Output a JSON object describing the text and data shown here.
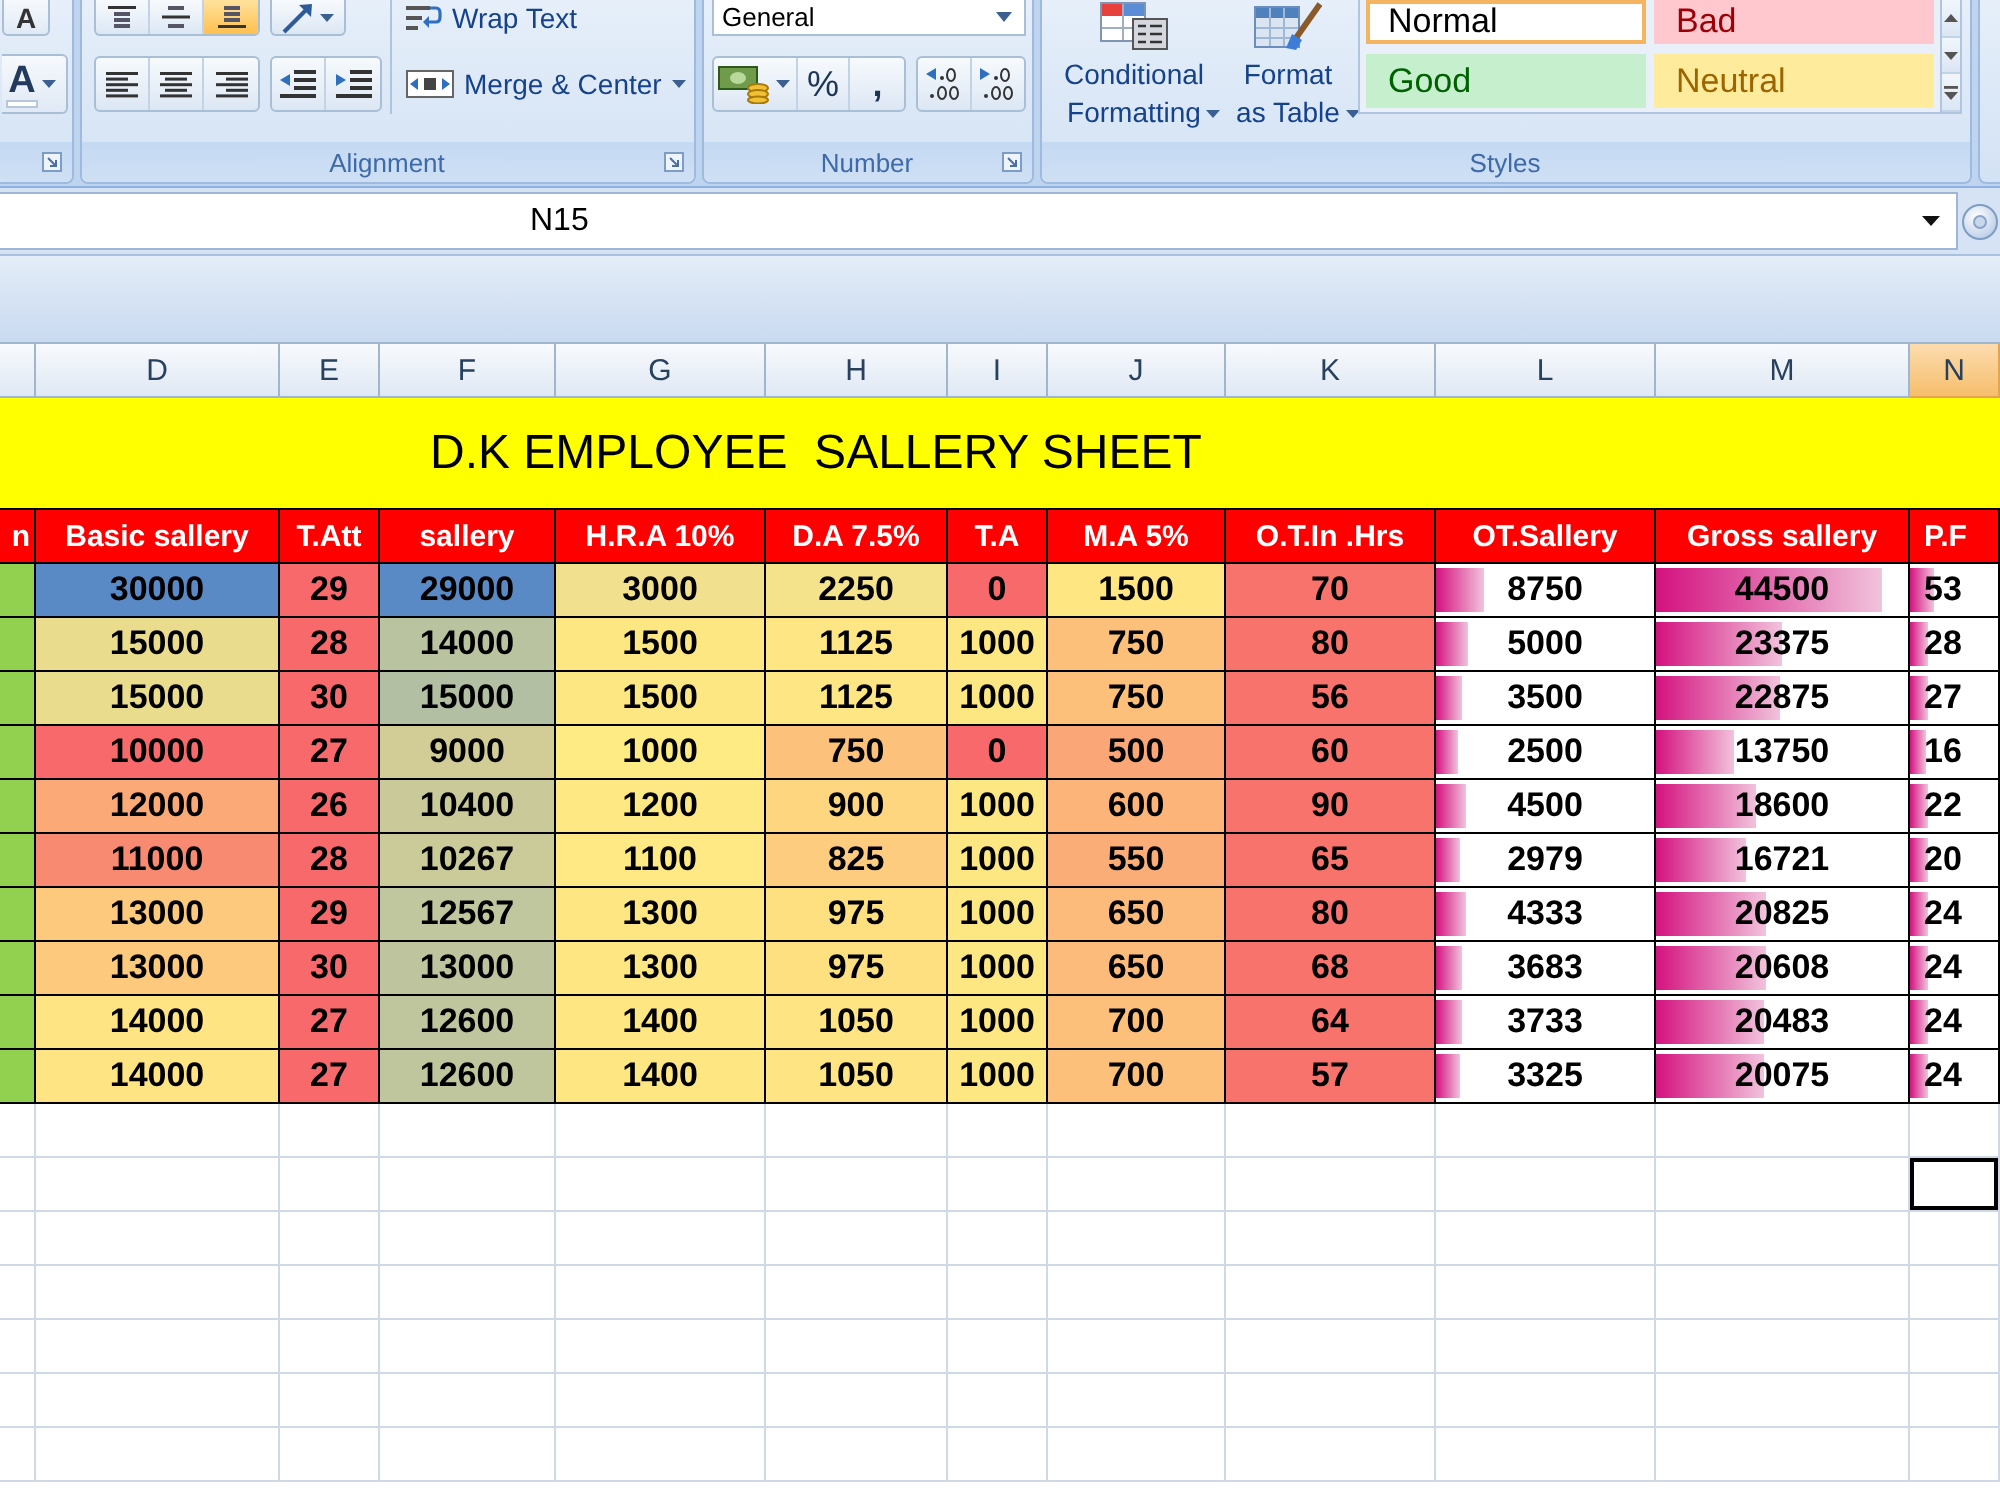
{
  "ribbon": {
    "font_group": {
      "grow_font_button": "A",
      "font_color_button": "A"
    },
    "alignment_group": {
      "vertical_align_buttons": [
        {
          "kind": "top",
          "selected": false
        },
        {
          "kind": "middle",
          "selected": false
        },
        {
          "kind": "bottom",
          "selected": true
        }
      ],
      "wrap_text_button": "Wrap Text",
      "merge_center_button": "Merge & Center",
      "label": "Alignment"
    },
    "number_group": {
      "format_dropdown": "General",
      "percent_button": "%",
      "comma_button": ",",
      "label": "Number"
    },
    "styles_group": {
      "conditional_formatting_button": "Conditional Formatting",
      "format_as_table_button": "Format as Table",
      "cell_styles": [
        {
          "label": "Normal",
          "kind": "normal",
          "selected": true
        },
        {
          "label": "Bad",
          "kind": "bad",
          "selected": false
        },
        {
          "label": "Good",
          "kind": "good",
          "selected": false
        },
        {
          "label": "Neutral",
          "kind": "neutral",
          "selected": false
        }
      ],
      "label": "Styles"
    }
  },
  "formula_bar": {
    "name_box": "N15"
  },
  "sheet": {
    "columns": [
      {
        "selected": false
      },
      {
        "label": "D",
        "selected": false
      },
      {
        "label": "E",
        "selected": false
      },
      {
        "label": "F",
        "selected": false
      },
      {
        "label": "G",
        "selected": false
      },
      {
        "label": "H",
        "selected": false
      },
      {
        "label": "I",
        "selected": false
      },
      {
        "label": "J",
        "selected": false
      },
      {
        "label": "K",
        "selected": false
      },
      {
        "label": "L",
        "selected": false
      },
      {
        "label": "M",
        "selected": false
      },
      {
        "label": "N",
        "selected": true
      }
    ],
    "title": "D.K EMPLOYEE  SALLERY SHEET",
    "header": [
      "n",
      "Basic sallery",
      "T.Att",
      "sallery",
      "H.R.A 10%",
      "D.A 7.5%",
      "T.A",
      "M.A 5%",
      "O.T.In .Hrs",
      "OT.Sallery",
      "Gross sallery",
      "P.F"
    ],
    "rows": [
      {
        "cells": [
          {
            "color": "#92d050"
          },
          {
            "text": "30000",
            "color": "#5a8ac6"
          },
          {
            "text": "29",
            "color": "#f8696b"
          },
          {
            "text": "29000",
            "color": "#5a8ac6"
          },
          {
            "text": "3000",
            "color": "#f1e08d"
          },
          {
            "text": "2250",
            "color": "#f4e38a"
          },
          {
            "text": "0",
            "color": "#f8696b"
          },
          {
            "text": "1500",
            "color": "#fee783"
          },
          {
            "text": "70",
            "color": "#f8736c"
          },
          {
            "text": "8750",
            "level": 0.22
          },
          {
            "text": "44500",
            "level": 0.9
          },
          {
            "text": "53",
            "level": 0.28
          }
        ]
      },
      {
        "cells": [
          {
            "color": "#92d050"
          },
          {
            "text": "15000",
            "color": "#e9dd8d"
          },
          {
            "text": "28",
            "color": "#f8696b"
          },
          {
            "text": "14000",
            "color": "#b9c3a0"
          },
          {
            "text": "1500",
            "color": "#fde783"
          },
          {
            "text": "1125",
            "color": "#fde683"
          },
          {
            "text": "1000",
            "color": "#fde783"
          },
          {
            "text": "750",
            "color": "#fcc07b"
          },
          {
            "text": "80",
            "color": "#f8736c"
          },
          {
            "text": "5000",
            "level": 0.15
          },
          {
            "text": "23375",
            "level": 0.5
          },
          {
            "text": "28",
            "level": 0.2
          }
        ]
      },
      {
        "cells": [
          {
            "color": "#92d050"
          },
          {
            "text": "15000",
            "color": "#e9dd8d"
          },
          {
            "text": "30",
            "color": "#f8696b"
          },
          {
            "text": "15000",
            "color": "#b3bfa3"
          },
          {
            "text": "1500",
            "color": "#fde783"
          },
          {
            "text": "1125",
            "color": "#fde683"
          },
          {
            "text": "1000",
            "color": "#fde783"
          },
          {
            "text": "750",
            "color": "#fcc07b"
          },
          {
            "text": "56",
            "color": "#f8736c"
          },
          {
            "text": "3500",
            "level": 0.12
          },
          {
            "text": "22875",
            "level": 0.49
          },
          {
            "text": "27",
            "level": 0.2
          }
        ]
      },
      {
        "cells": [
          {
            "color": "#92d050"
          },
          {
            "text": "10000",
            "color": "#f8696b"
          },
          {
            "text": "27",
            "color": "#f8696b"
          },
          {
            "text": "9000",
            "color": "#d2cd96"
          },
          {
            "text": "1000",
            "color": "#ffeb84"
          },
          {
            "text": "750",
            "color": "#fcc27b"
          },
          {
            "text": "0",
            "color": "#f8696b"
          },
          {
            "text": "500",
            "color": "#fba677"
          },
          {
            "text": "60",
            "color": "#f8736c"
          },
          {
            "text": "2500",
            "level": 0.1
          },
          {
            "text": "13750",
            "level": 0.31
          },
          {
            "text": "16",
            "level": 0.18
          }
        ]
      },
      {
        "cells": [
          {
            "color": "#92d050"
          },
          {
            "text": "12000",
            "color": "#fbaa77"
          },
          {
            "text": "26",
            "color": "#f8696b"
          },
          {
            "text": "10400",
            "color": "#cac99a"
          },
          {
            "text": "1200",
            "color": "#fee883"
          },
          {
            "text": "900",
            "color": "#fed680"
          },
          {
            "text": "1000",
            "color": "#fde783"
          },
          {
            "text": "600",
            "color": "#fcb479"
          },
          {
            "text": "90",
            "color": "#f8736c"
          },
          {
            "text": "4500",
            "level": 0.14
          },
          {
            "text": "18600",
            "level": 0.4
          },
          {
            "text": "22",
            "level": 0.2
          }
        ]
      },
      {
        "cells": [
          {
            "color": "#92d050"
          },
          {
            "text": "11000",
            "color": "#f98a72"
          },
          {
            "text": "28",
            "color": "#f8696b"
          },
          {
            "text": "10267",
            "color": "#cbca99"
          },
          {
            "text": "1100",
            "color": "#fee984"
          },
          {
            "text": "825",
            "color": "#fdcc7e"
          },
          {
            "text": "1000",
            "color": "#fde783"
          },
          {
            "text": "550",
            "color": "#fbad78"
          },
          {
            "text": "65",
            "color": "#f8736c"
          },
          {
            "text": "2979",
            "level": 0.11
          },
          {
            "text": "16721",
            "level": 0.36
          },
          {
            "text": "20",
            "level": 0.2
          }
        ]
      },
      {
        "cells": [
          {
            "color": "#92d050"
          },
          {
            "text": "13000",
            "color": "#fdc97d"
          },
          {
            "text": "29",
            "color": "#f8696b"
          },
          {
            "text": "12567",
            "color": "#c0c69d"
          },
          {
            "text": "1300",
            "color": "#fee783"
          },
          {
            "text": "975",
            "color": "#fee081"
          },
          {
            "text": "1000",
            "color": "#fde783"
          },
          {
            "text": "650",
            "color": "#fcbb7a"
          },
          {
            "text": "80",
            "color": "#f8736c"
          },
          {
            "text": "4333",
            "level": 0.14
          },
          {
            "text": "20825",
            "level": 0.44
          },
          {
            "text": "24",
            "level": 0.2
          }
        ]
      },
      {
        "cells": [
          {
            "color": "#92d050"
          },
          {
            "text": "13000",
            "color": "#fdc97d"
          },
          {
            "text": "30",
            "color": "#f8696b"
          },
          {
            "text": "13000",
            "color": "#bdc49e"
          },
          {
            "text": "1300",
            "color": "#fee783"
          },
          {
            "text": "975",
            "color": "#fee081"
          },
          {
            "text": "1000",
            "color": "#fde783"
          },
          {
            "text": "650",
            "color": "#fcbb7a"
          },
          {
            "text": "68",
            "color": "#f8736c"
          },
          {
            "text": "3683",
            "level": 0.12
          },
          {
            "text": "20608",
            "level": 0.44
          },
          {
            "text": "24",
            "level": 0.2
          }
        ]
      },
      {
        "cells": [
          {
            "color": "#92d050"
          },
          {
            "text": "14000",
            "color": "#fee482"
          },
          {
            "text": "27",
            "color": "#f8696b"
          },
          {
            "text": "12600",
            "color": "#bfc59d"
          },
          {
            "text": "1400",
            "color": "#fee783"
          },
          {
            "text": "1050",
            "color": "#fee482"
          },
          {
            "text": "1000",
            "color": "#fde783"
          },
          {
            "text": "700",
            "color": "#fcc07b"
          },
          {
            "text": "64",
            "color": "#f8736c"
          },
          {
            "text": "3733",
            "level": 0.12
          },
          {
            "text": "20483",
            "level": 0.43
          },
          {
            "text": "24",
            "level": 0.2
          }
        ]
      },
      {
        "cells": [
          {
            "color": "#92d050"
          },
          {
            "text": "14000",
            "color": "#fee482"
          },
          {
            "text": "27",
            "color": "#f8696b"
          },
          {
            "text": "12600",
            "color": "#bfc59d"
          },
          {
            "text": "1400",
            "color": "#fee783"
          },
          {
            "text": "1050",
            "color": "#fee482"
          },
          {
            "text": "1000",
            "color": "#fde783"
          },
          {
            "text": "700",
            "color": "#fcc07b"
          },
          {
            "text": "57",
            "color": "#f8736c"
          },
          {
            "text": "3325",
            "level": 0.11
          },
          {
            "text": "20075",
            "level": 0.43
          },
          {
            "text": "24",
            "level": 0.2
          }
        ]
      }
    ],
    "blank_rows": [
      {
        "cells": [
          {
            "selected": false
          },
          {
            "selected": false
          },
          {
            "selected": false
          },
          {
            "selected": false
          },
          {
            "selected": false
          },
          {
            "selected": false
          },
          {
            "selected": false
          },
          {
            "selected": false
          },
          {
            "selected": false
          },
          {
            "selected": false
          },
          {
            "selected": false
          },
          {
            "selected": false
          }
        ]
      },
      {
        "cells": [
          {
            "selected": false
          },
          {
            "selected": false
          },
          {
            "selected": false
          },
          {
            "selected": false
          },
          {
            "selected": false
          },
          {
            "selected": false
          },
          {
            "selected": false
          },
          {
            "selected": false
          },
          {
            "selected": false
          },
          {
            "selected": false
          },
          {
            "selected": false
          },
          {
            "selected": true
          }
        ]
      },
      {
        "cells": [
          {
            "selected": false
          },
          {
            "selected": false
          },
          {
            "selected": false
          },
          {
            "selected": false
          },
          {
            "selected": false
          },
          {
            "selected": false
          },
          {
            "selected": false
          },
          {
            "selected": false
          },
          {
            "selected": false
          },
          {
            "selected": false
          },
          {
            "selected": false
          },
          {
            "selected": false
          }
        ]
      },
      {
        "cells": [
          {
            "selected": false
          },
          {
            "selected": false
          },
          {
            "selected": false
          },
          {
            "selected": false
          },
          {
            "selected": false
          },
          {
            "selected": false
          },
          {
            "selected": false
          },
          {
            "selected": false
          },
          {
            "selected": false
          },
          {
            "selected": false
          },
          {
            "selected": false
          },
          {
            "selected": false
          }
        ]
      },
      {
        "cells": [
          {
            "selected": false
          },
          {
            "selected": false
          },
          {
            "selected": false
          },
          {
            "selected": false
          },
          {
            "selected": false
          },
          {
            "selected": false
          },
          {
            "selected": false
          },
          {
            "selected": false
          },
          {
            "selected": false
          },
          {
            "selected": false
          },
          {
            "selected": false
          },
          {
            "selected": false
          }
        ]
      },
      {
        "cells": [
          {
            "selected": false
          },
          {
            "selected": false
          },
          {
            "selected": false
          },
          {
            "selected": false
          },
          {
            "selected": false
          },
          {
            "selected": false
          },
          {
            "selected": false
          },
          {
            "selected": false
          },
          {
            "selected": false
          },
          {
            "selected": false
          },
          {
            "selected": false
          },
          {
            "selected": false
          }
        ]
      },
      {
        "cells": [
          {
            "selected": false
          },
          {
            "selected": false
          },
          {
            "selected": false
          },
          {
            "selected": false
          },
          {
            "selected": false
          },
          {
            "selected": false
          },
          {
            "selected": false
          },
          {
            "selected": false
          },
          {
            "selected": false
          },
          {
            "selected": false
          },
          {
            "selected": false
          },
          {
            "selected": false
          }
        ]
      }
    ]
  }
}
